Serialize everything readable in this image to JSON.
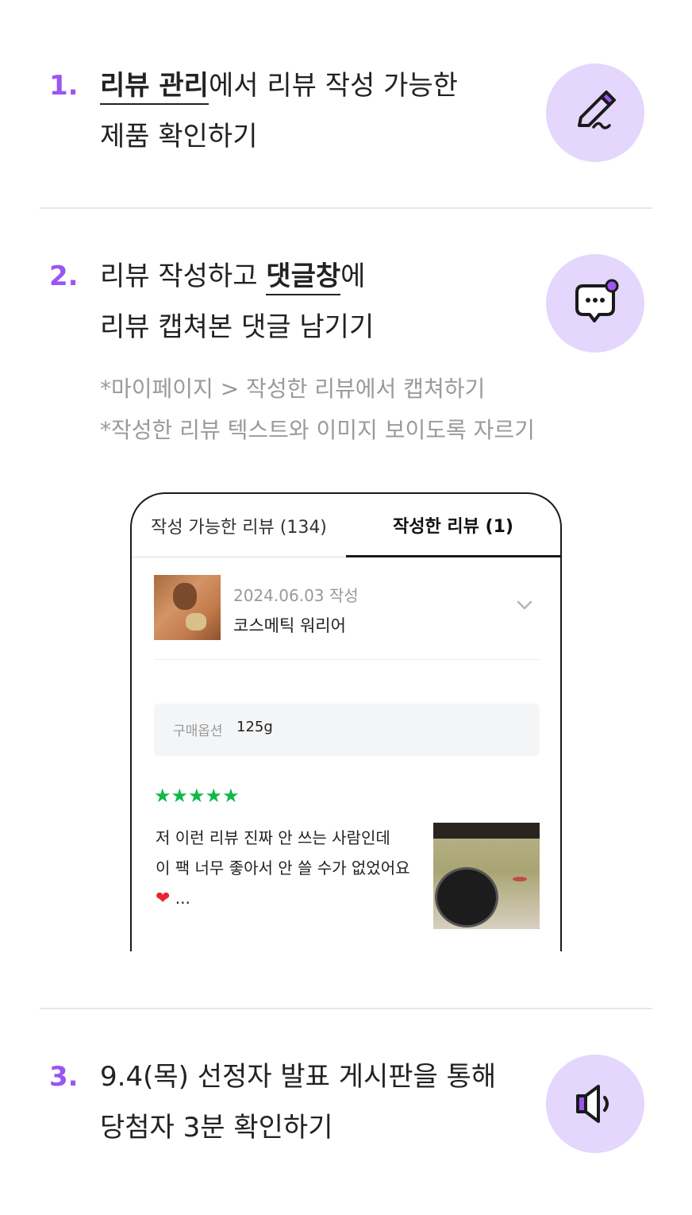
{
  "step1": {
    "number": "1.",
    "bold": "리뷰 관리",
    "line1_rest": "에서 리뷰 작성 가능한",
    "line2": "제품 확인하기",
    "icon": "pencil-icon"
  },
  "step2": {
    "number": "2.",
    "line1_pre": "리뷰 작성하고 ",
    "bold": "댓글창",
    "line1_post": "에",
    "line2": "리뷰 캡쳐본 댓글 남기기",
    "note1": "*마이페이지 > 작성한 리뷰에서 캡쳐하기",
    "note2": "*작성한 리뷰 텍스트와 이미지 보이도록 자르기",
    "icon": "chat-bubble-icon"
  },
  "phone": {
    "tab_available": "작성 가능한 리뷰 (134)",
    "tab_written": "작성한 리뷰 (1)",
    "review_date": "2024.06.03 작성",
    "product_name": "코스메틱 워리어",
    "option_label": "구매옵션",
    "option_value": "125g",
    "stars": "★★★★★",
    "review_line1": "저 이런 리뷰 진짜 안 쓰는 사람인데",
    "review_line2": "이 팩 너무 좋아서 안 쓸 수가 없었어요",
    "review_heart": "❤",
    "review_ellipsis": " ..."
  },
  "step3": {
    "number": "3.",
    "line1": "9.4(목) 선정자 발표 게시판을 통해",
    "line2": "당첨자 3분 확인하기",
    "icon": "speaker-icon"
  },
  "colors": {
    "accent": "#9a55f2",
    "icon_bg": "#e4d6fd",
    "star": "#12b94a"
  }
}
